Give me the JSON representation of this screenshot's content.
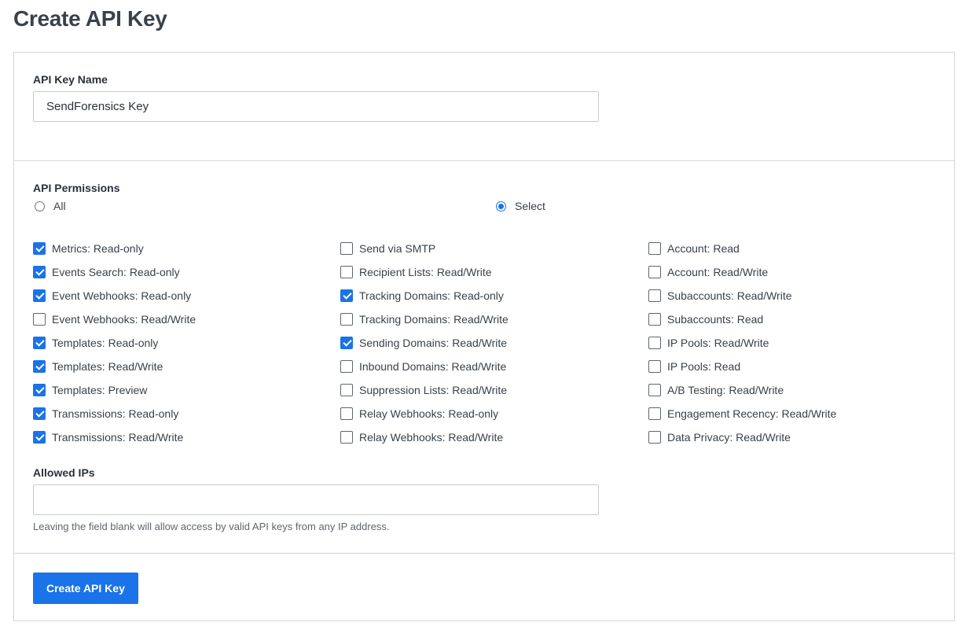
{
  "page": {
    "title": "Create API Key"
  },
  "name_section": {
    "label": "API Key Name",
    "value": "SendForensics Key"
  },
  "permissions": {
    "label": "API Permissions",
    "scope_options": [
      {
        "label": "All",
        "selected": false
      },
      {
        "label": "Select",
        "selected": true
      }
    ],
    "columns": [
      [
        {
          "label": "Metrics: Read-only",
          "checked": true
        },
        {
          "label": "Events Search: Read-only",
          "checked": true
        },
        {
          "label": "Event Webhooks: Read-only",
          "checked": true
        },
        {
          "label": "Event Webhooks: Read/Write",
          "checked": false
        },
        {
          "label": "Templates: Read-only",
          "checked": true
        },
        {
          "label": "Templates: Read/Write",
          "checked": true
        },
        {
          "label": "Templates: Preview",
          "checked": true
        },
        {
          "label": "Transmissions: Read-only",
          "checked": true
        },
        {
          "label": "Transmissions: Read/Write",
          "checked": true
        }
      ],
      [
        {
          "label": "Send via SMTP",
          "checked": false
        },
        {
          "label": "Recipient Lists: Read/Write",
          "checked": false
        },
        {
          "label": "Tracking Domains: Read-only",
          "checked": true
        },
        {
          "label": "Tracking Domains: Read/Write",
          "checked": false
        },
        {
          "label": "Sending Domains: Read/Write",
          "checked": true
        },
        {
          "label": "Inbound Domains: Read/Write",
          "checked": false
        },
        {
          "label": "Suppression Lists: Read/Write",
          "checked": false
        },
        {
          "label": "Relay Webhooks: Read-only",
          "checked": false
        },
        {
          "label": "Relay Webhooks: Read/Write",
          "checked": false
        }
      ],
      [
        {
          "label": "Account: Read",
          "checked": false
        },
        {
          "label": "Account: Read/Write",
          "checked": false
        },
        {
          "label": "Subaccounts: Read/Write",
          "checked": false
        },
        {
          "label": "Subaccounts: Read",
          "checked": false
        },
        {
          "label": "IP Pools: Read/Write",
          "checked": false
        },
        {
          "label": "IP Pools: Read",
          "checked": false
        },
        {
          "label": "A/B Testing: Read/Write",
          "checked": false
        },
        {
          "label": "Engagement Recency: Read/Write",
          "checked": false
        },
        {
          "label": "Data Privacy: Read/Write",
          "checked": false
        }
      ]
    ]
  },
  "allowed_ips": {
    "label": "Allowed IPs",
    "value": "",
    "help": "Leaving the field blank will allow access by valid API keys from any IP address."
  },
  "actions": {
    "submit_label": "Create API Key"
  },
  "colors": {
    "accent": "#1a73e8",
    "border": "#d4d6d9",
    "title": "#39414b"
  }
}
